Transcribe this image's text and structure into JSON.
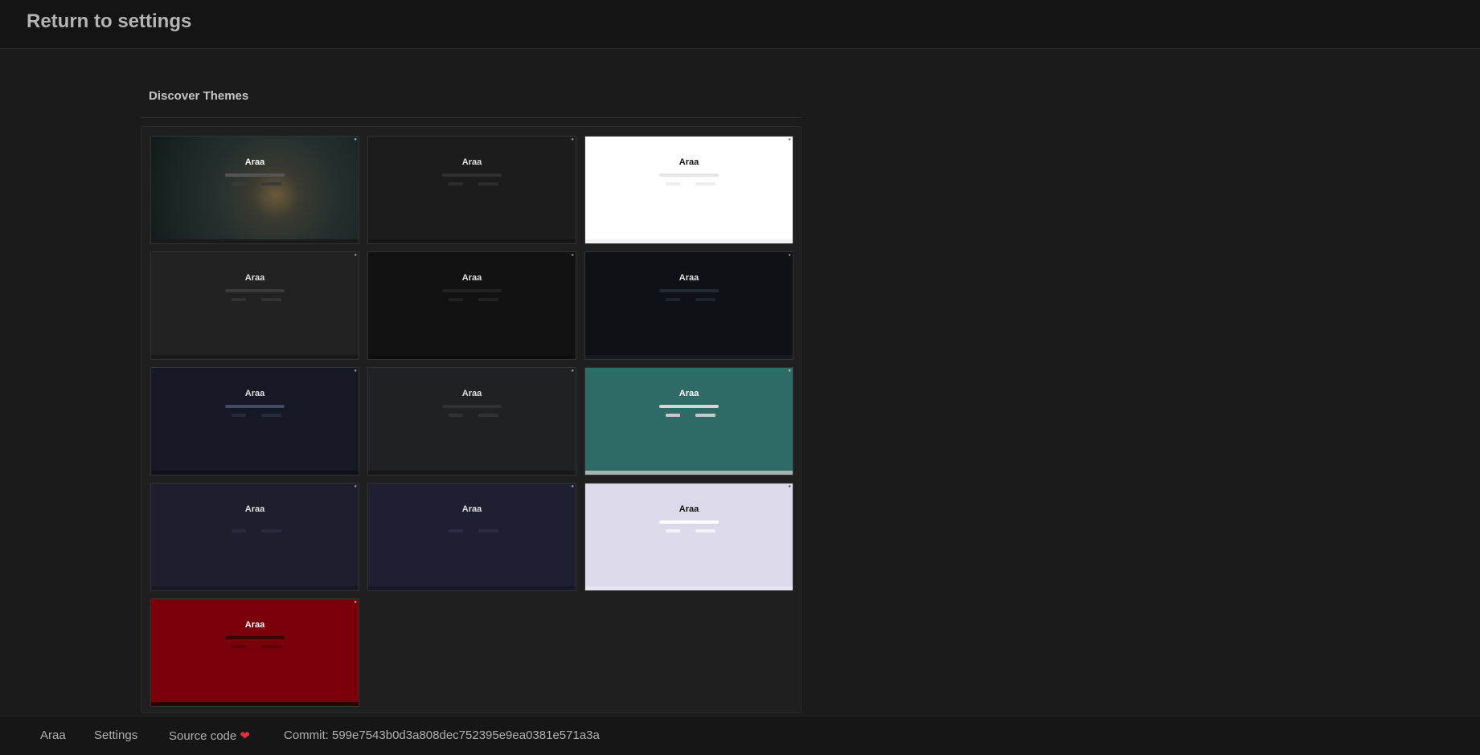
{
  "header": {
    "back_label": "Return to settings"
  },
  "section": {
    "title": "Discover Themes"
  },
  "themes": [
    {
      "logo": "Araa",
      "bg": "#2a3a3d",
      "text": "#ffffff",
      "bar": "#555555",
      "btn": "#3a3a3a",
      "foot": "#1a1a1a",
      "photo": true
    },
    {
      "logo": "Araa",
      "bg": "#1c1c1c",
      "text": "#e0e0e0",
      "bar": "#2f2f2f",
      "btn": "#2c2c2c",
      "foot": "#161616"
    },
    {
      "logo": "Araa",
      "bg": "#ffffff",
      "text": "#111111",
      "bar": "#e6e6e6",
      "btn": "#eeeeee",
      "foot": "#f3f3f3"
    },
    {
      "logo": "Araa",
      "bg": "#222222",
      "text": "#e0e0e0",
      "bar": "#3a3a3a",
      "btn": "#333333",
      "foot": "#1a1a1a"
    },
    {
      "logo": "Araa",
      "bg": "#121212",
      "text": "#e0e0e0",
      "bar": "#222222",
      "btn": "#222222",
      "foot": "#0e0e0e"
    },
    {
      "logo": "Araa",
      "bg": "#0e1116",
      "text": "#e0e0e0",
      "bar": "#242a33",
      "btn": "#1f242c",
      "foot": "#161b22"
    },
    {
      "logo": "Araa",
      "bg": "#161826",
      "text": "#e0e0e0",
      "bar": "#414868",
      "btn": "#262a3d",
      "foot": "#0f111a"
    },
    {
      "logo": "Araa",
      "bg": "#202124",
      "text": "#e0e0e0",
      "bar": "#303134",
      "btn": "#303134",
      "foot": "#171717"
    },
    {
      "logo": "Araa",
      "bg": "#2f6b66",
      "text": "#ffffff",
      "bar": "#d6d6d6",
      "btn": "#c8c8c8",
      "foot": "#a9b3b1"
    },
    {
      "logo": "Araa",
      "bg": "#1e1e2e",
      "text": "#e0e0e0",
      "bar": "#1e1e2e",
      "btn": "#2a2a3c",
      "foot": "#181825"
    },
    {
      "logo": "Araa",
      "bg": "#1f1f32",
      "text": "#e0e0e0",
      "bar": "#1f1f32",
      "btn": "#2b2b42",
      "foot": "#17172a"
    },
    {
      "logo": "Araa",
      "bg": "#dcdaea",
      "text": "#111111",
      "bar": "#ffffff",
      "btn": "#f3f2fa",
      "foot": "#e6e4f0"
    },
    {
      "logo": "Araa",
      "bg": "#7a000c",
      "text": "#ffffff",
      "bar": "#3a0006",
      "btn": "#5a0009",
      "foot": "#2a0004"
    }
  ],
  "footer": {
    "brand": "Araa",
    "settings": "Settings",
    "source_code": "Source code",
    "heart": "❤",
    "commit": "Commit: 599e7543b0d3a808dec752395e9ea0381e571a3a"
  }
}
